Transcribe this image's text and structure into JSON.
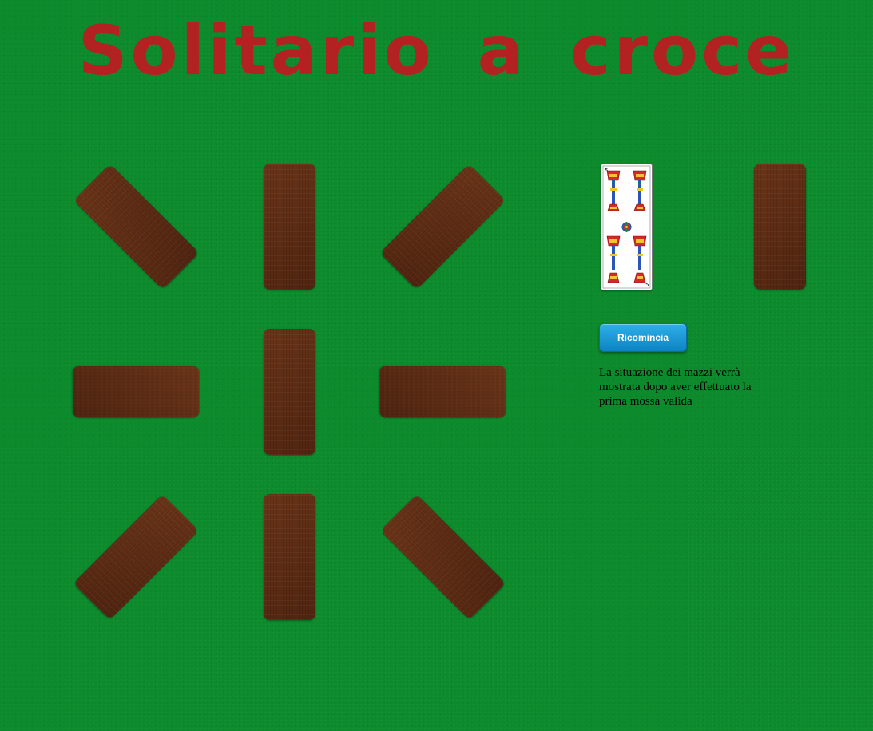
{
  "title": "Solitario a croce",
  "piles": [
    {
      "name": "pile-top-left",
      "type": "face-down"
    },
    {
      "name": "pile-top-center",
      "type": "face-down"
    },
    {
      "name": "pile-top-right",
      "type": "face-down"
    },
    {
      "name": "pile-middle-left",
      "type": "face-down"
    },
    {
      "name": "pile-center",
      "type": "face-down"
    },
    {
      "name": "pile-middle-right",
      "type": "face-down"
    },
    {
      "name": "pile-bottom-left",
      "type": "face-down"
    },
    {
      "name": "pile-bottom-center",
      "type": "face-down"
    },
    {
      "name": "pile-bottom-right",
      "type": "face-down"
    }
  ],
  "current_card": {
    "rank": "5",
    "suit": "coppe"
  },
  "deck": {
    "type": "face-down"
  },
  "restart_label": "Ricomincia",
  "status_message": "La situazione dei mazzi verrà mostrata dopo aver effettuato la prima mossa valida",
  "colors": {
    "felt": "#0c8a2c",
    "title": "#b22222",
    "card_back": "#5c2c14",
    "button": "#1a9ad6"
  }
}
